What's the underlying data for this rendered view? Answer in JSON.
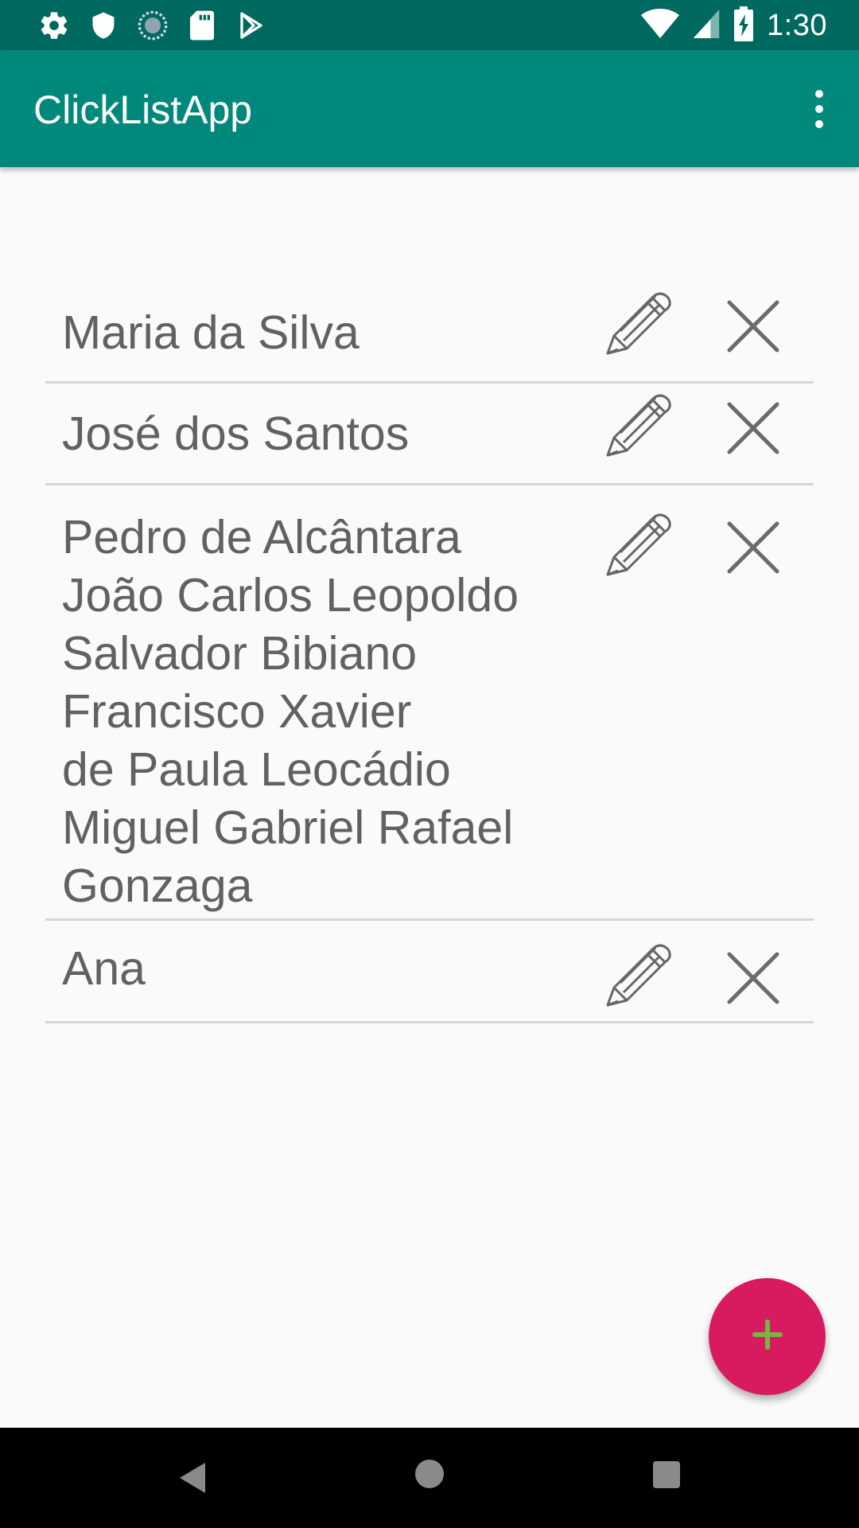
{
  "status_bar": {
    "time": "1:30",
    "left_icons": [
      "settings-icon",
      "shield-icon",
      "sync-icon",
      "sd-card-icon",
      "play-store-icon"
    ],
    "right_icons": [
      "wifi-icon",
      "signal-icon",
      "battery-charging-icon"
    ]
  },
  "app_bar": {
    "title": "ClickListApp",
    "menu_icon": "overflow-menu-icon"
  },
  "list": {
    "items": [
      {
        "name": "Maria da Silva"
      },
      {
        "name": "José dos Santos"
      },
      {
        "name": "Pedro de Alcântara\nJoão Carlos Leopoldo\nSalvador Bibiano\nFrancisco Xavier\nde Paula Leocádio\nMiguel Gabriel Rafael\nGonzaga"
      },
      {
        "name": "Ana"
      }
    ],
    "edit_icon": "pencil-icon",
    "delete_icon": "close-icon"
  },
  "fab": {
    "icon": "plus-icon",
    "color": "#d81b60",
    "icon_color": "#7cb342"
  },
  "colors": {
    "primary": "#00897b",
    "primary_dark": "#00695f",
    "text": "#616161"
  }
}
